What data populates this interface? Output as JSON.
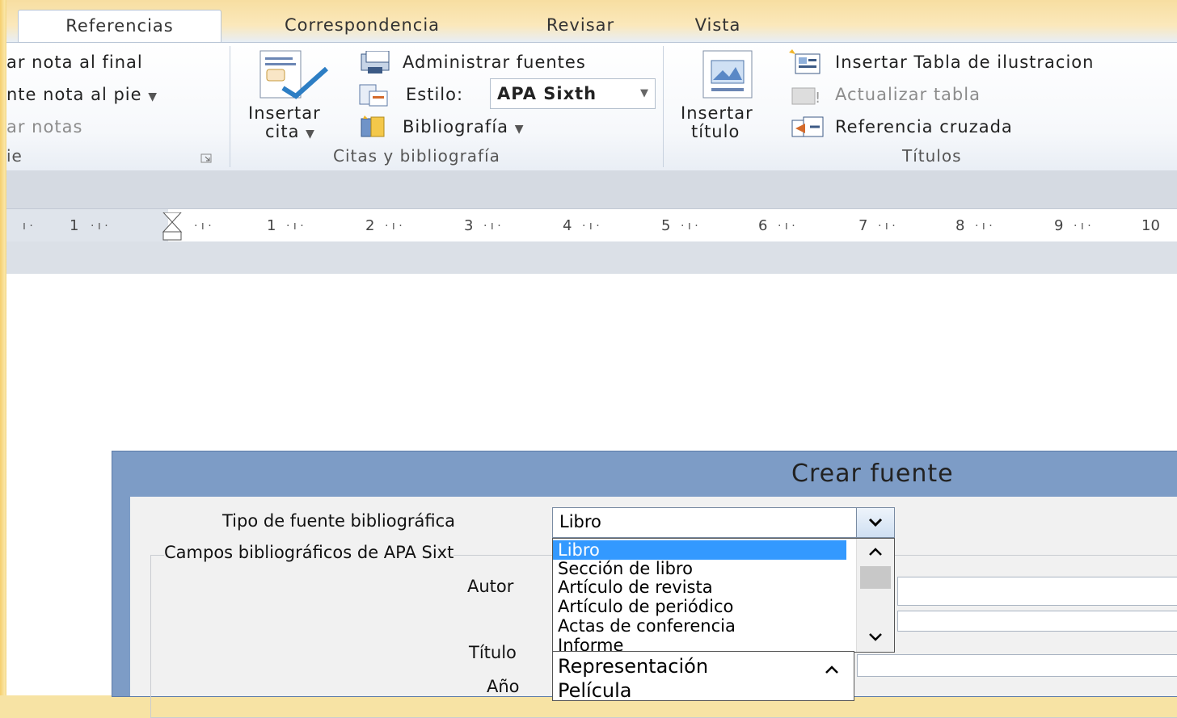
{
  "tabs": [
    "Referencias",
    "Correspondencia",
    "Revisar",
    "Vista"
  ],
  "footnotes_group": {
    "insert_endnote": "ar nota al final",
    "next_footnote": "nte nota al pie",
    "show_notes": "ar notas",
    "label": "ie"
  },
  "citations_group": {
    "insert_citation": "Insertar",
    "insert_citation_2": "cita",
    "manage_sources": "Administrar fuentes",
    "style_label": "Estilo:",
    "style_value": "APA Sixth",
    "bibliography": "Bibliografía",
    "label": "Citas y bibliografía"
  },
  "captions_group": {
    "insert_caption": "Insertar",
    "insert_caption_2": "título",
    "insert_table_of_figures": "Insertar Tabla de ilustracion",
    "update_table": "Actualizar tabla",
    "cross_reference": "Referencia cruzada",
    "label": "Títulos"
  },
  "ruler": {
    "numbers": [
      "1",
      "1",
      "2",
      "3",
      "4",
      "5",
      "6",
      "7",
      "8",
      "9",
      "10"
    ]
  },
  "dialog": {
    "title": "Crear fuente",
    "source_type_label": "Tipo de fuente bibliográfica",
    "source_type_value": "Libro",
    "fields_group": "Campos bibliográficos de APA Sixt",
    "author_label": "Autor",
    "title_label": "Título",
    "year_label": "Año",
    "dropdown_options": [
      "Libro",
      "Sección de libro",
      "Artículo de revista",
      "Artículo de periódico",
      "Actas de conferencia",
      "Informe"
    ],
    "second_list": [
      "Representación",
      "Película"
    ]
  },
  "colors": {
    "selection": "#3399ff",
    "dialog_border": "#7d9cc6"
  }
}
